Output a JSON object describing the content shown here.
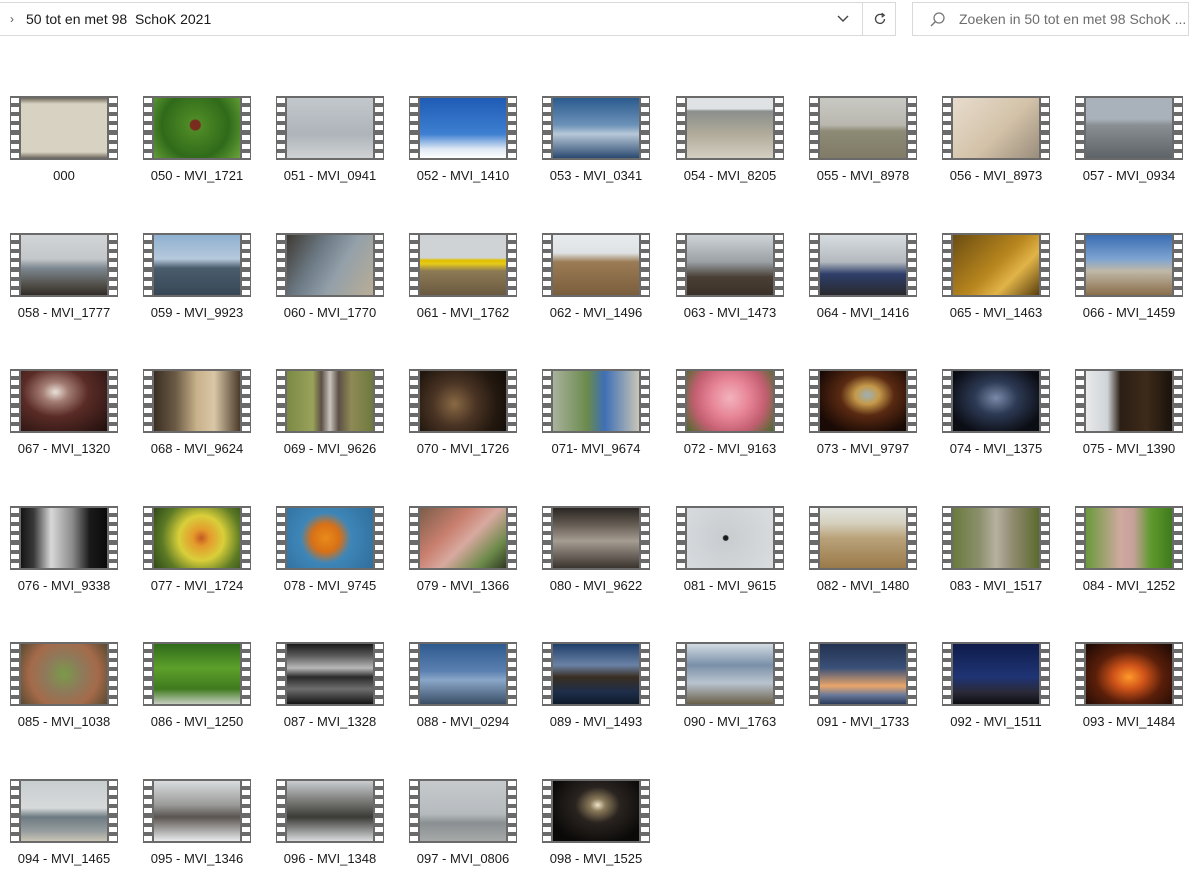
{
  "address_bar": {
    "path": "50 tot en met 98  SchoK 2021",
    "icons": {
      "expand": "chevron-right-icon",
      "dropdown": "chevron-down-icon",
      "refresh": "refresh-icon"
    }
  },
  "search": {
    "placeholder": "Zoeken in 50 tot en met 98  SchoK ...",
    "icon": "search-icon"
  },
  "files": [
    {
      "name": "000",
      "thumb": "linear-gradient(#6f6a5e 0%,#d8d2c2 10%,#d8d2c2 90%,#6f6a5e 100%)"
    },
    {
      "name": "050 - MVI_1721",
      "thumb": "radial-gradient(circle at 48% 45%,#7a2d1f 0,#7a2d1f 9%,#4e8a25 11%,#2f6a1a 60%,#6aa33a 100%)"
    },
    {
      "name": "051 - MVI_0941",
      "thumb": "linear-gradient(#c3c8cc,#aeb4ba 60%,#cfd2d4)"
    },
    {
      "name": "052 - MVI_1410",
      "thumb": "linear-gradient(#1f5bb5 0%,#3e7fd1 60%,#dfe9f5 85%,#ffffff 100%)"
    },
    {
      "name": "053 - MVI_0341",
      "thumb": "linear-gradient(#2a5a8e 0%,#6c92b8 45%,#b7c8d8 60%,#2b4a70 100%)"
    },
    {
      "name": "054 - MVI_8205",
      "thumb": "linear-gradient(#dfe3e6 0%,#dfe3e6 18%,#8a8f8c 22%,#b1ab9a 60%,#d3cfc2 100%)"
    },
    {
      "name": "055 - MVI_8978",
      "thumb": "linear-gradient(#c9c9c4 0%,#b9b7ae 45%,#8d8a76 55%,#7f7b66 100%)"
    },
    {
      "name": "056 - MVI_8973",
      "thumb": "linear-gradient(135deg,#e7dccd,#d3c2a8 55%,#9a8d7c)"
    },
    {
      "name": "057 - MVI_0934",
      "thumb": "linear-gradient(#a9b2ba 0%,#a9b2ba 35%,#8a8f94 45%,#5e6368 100%)"
    },
    {
      "name": "058 - MVI_1777",
      "thumb": "linear-gradient(#d2d5d7 0%,#c4c7c9 40%,#7d8892 55%,#4f4b45 85%,#302b26 100%)"
    },
    {
      "name": "059 - MVI_9923",
      "thumb": "linear-gradient(#8fb0d0 0%,#b6c9dc 40%,#4a5d6d 55%,#374756 100%)"
    },
    {
      "name": "060 - MVI_1770",
      "thumb": "linear-gradient(120deg,#3f3a33 0%,#6d7b86 35%,#93a0aa 60%,#b9ad95 100%)"
    },
    {
      "name": "061 - MVI_1762",
      "thumb": "linear-gradient(#cfd3d6 0%,#cfd3d6 38%,#e0c000 42%,#e7c91a 48%,#8d7a55 60%,#6a5a40 100%)"
    },
    {
      "name": "062 - MVI_1496",
      "thumb": "linear-gradient(#e9ecee 0%,#dfe2e4 30%,#9a7b55 45%,#7b5e3d 100%)"
    },
    {
      "name": "063 - MVI_1473",
      "thumb": "linear-gradient(#cfd4d8 0%,#9aa0a4 45%,#4a3f35 70%,#3a3128 100%)"
    },
    {
      "name": "064 - MVI_1416",
      "thumb": "linear-gradient(#d8dde1 0%,#b3b9be 45%,#2e3f6a 65%,#2a2a2e 100%)"
    },
    {
      "name": "065 - MVI_1463",
      "thumb": "linear-gradient(135deg,#6b4d12,#b8861e 50%,#e1b448 70%,#5a3f0e)"
    },
    {
      "name": "066 - MVI_1459",
      "thumb": "linear-gradient(#3a6db2 0%,#7ea4d1 40%,#c0b8a8 60%,#8a6e4a 100%)"
    },
    {
      "name": "067 - MVI_1320",
      "thumb": "radial-gradient(ellipse at 40% 35%,#e9e2d8 0,#a37c73 18%,#5a2b26 45%,#1f0f0d 100%)"
    },
    {
      "name": "068 - MVI_9624",
      "thumb": "linear-gradient(90deg,#3a2f24 0%,#6b5a45 25%,#c9b28c 50%,#d9c7a6 70%,#4a3b2b 100%)"
    },
    {
      "name": "069 - MVI_9626",
      "thumb": "linear-gradient(90deg,#7a8a45 0%,#9aa25a 30%,#5c5046 40%,#c9c4bd 50%,#5c5046 60%,#8f8a55 75%,#6d7a3c 100%)"
    },
    {
      "name": "070 - MVI_1726",
      "thumb": "radial-gradient(circle at 40% 55%,#8a6a45 0,#4a3424 35%,#23180f 70%,#120c08 100%)"
    },
    {
      "name": "071- MVI_9674",
      "thumb": "linear-gradient(90deg,#a9b29c 0%,#6a8a4c 40%,#3e6fb5 60%,#c8c6b7 100%)"
    },
    {
      "name": "072 - MVI_9163",
      "thumb": "radial-gradient(circle at 50% 45%,#f2b3bd 0,#e78596 35%,#c45f72 65%,#4b6a2c 100%)"
    },
    {
      "name": "073 - MVI_9797",
      "thumb": "radial-gradient(ellipse at 55% 40%,#9fb0b8 0,#c59a4a 18%,#5a2a12 40%,#1a0a05 80%)"
    },
    {
      "name": "074 - MVI_1375",
      "thumb": "radial-gradient(ellipse at 50% 45%,#7a8aa8 0,#2d3a55 35%,#0b0d14 80%)"
    },
    {
      "name": "075 - MVI_1390",
      "thumb": "linear-gradient(90deg,#e8e9ea 0%,#cfd4d8 25%,#2b1e14 40%,#3d2a1a 70%,#1a120c 100%)"
    },
    {
      "name": "076 - MVI_9338",
      "thumb": "linear-gradient(90deg,#151515 0%,#3a3a3a 15%,#d8d8d8 35%,#8a8a8a 60%,#1a1a1a 80%,#0a0a0a 100%)"
    },
    {
      "name": "077 - MVI_1724",
      "thumb": "radial-gradient(circle at 55% 50%,#c35a22 0,#e49a2c 15%,#d9cf3a 40%,#5c7a25 70%,#2f4a18 100%)"
    },
    {
      "name": "078 - MVI_9745",
      "thumb": "radial-gradient(circle at 45% 50%,#e98b1a 0,#d87016 25%,#3e86b8 45%,#2f6e9c 100%)"
    },
    {
      "name": "079 - MVI_1366",
      "thumb": "linear-gradient(135deg,#7c5d4a,#c97f6e 35%,#d8a9a0 55%,#6d8a4a 80%,#2f3a22)"
    },
    {
      "name": "080 - MVI_9622",
      "thumb": "linear-gradient(#2a2622 0%,#6a6158 30%,#a59c92 55%,#3a342e 100%)"
    },
    {
      "name": "081 - MVI_9615",
      "thumb": "radial-gradient(circle at 45% 50%,#1a1a1a 0,#1a1a1a 4%,#c9cdd0 6%,#dadde0 100%)"
    },
    {
      "name": "082 - MVI_1480",
      "thumb": "linear-gradient(#e3e4df 0%,#d6d1bf 25%,#b9a27a 50%,#9a7a4a 100%)"
    },
    {
      "name": "083 - MVI_1517",
      "thumb": "linear-gradient(90deg,#6a7a3c 0%,#8a8f6a 30%,#b6b0a0 50%,#8f8a6e 70%,#5c6a2e 100%)"
    },
    {
      "name": "084 - MVI_1252",
      "thumb": "linear-gradient(90deg,#6a9a3a 0%,#cfa9a0 40%,#c7a09a 55%,#5f9a2e 75%,#3f7a1e 100%)"
    },
    {
      "name": "085 - MVI_1038",
      "thumb": "radial-gradient(circle at 50% 50%,#7a9a4a 0,#8e7a5a 35%,#a46a4a 65%,#5a4a30 100%)"
    },
    {
      "name": "086 - MVI_1250",
      "thumb": "linear-gradient(#2f6a1a 0%,#5da02a 40%,#3f7a1e 75%,#c7cfc0 100%)"
    },
    {
      "name": "087 - MVI_1328",
      "thumb": "linear-gradient(#1a1a1a 0%,#5c5c5c 20%,#b9b9b9 40%,#2a2a2a 55%,#6e6e6e 75%,#151515 100%)"
    },
    {
      "name": "088 - MVI_0294",
      "thumb": "linear-gradient(#2f5a8e 0%,#5a80b0 45%,#8aa7c9 60%,#3a4e66 100%)"
    },
    {
      "name": "089 - MVI_1493",
      "thumb": "linear-gradient(#1f3f6a 0%,#6a82a6 35%,#3a2e22 55%,#1e2e4a 80%,#0f1a2a 100%)"
    },
    {
      "name": "090 - MVI_1763",
      "thumb": "linear-gradient(#d2dbe3 0%,#7a90a8 35%,#b9c4cf 65%,#6a6048 100%)"
    },
    {
      "name": "091 - MVI_1733",
      "thumb": "linear-gradient(#223250 0%,#3a5078 40%,#e9a66a 70%,#6a7a9a 85%,#2a3a5a 100%)"
    },
    {
      "name": "092 - MVI_1511",
      "thumb": "linear-gradient(#0f1c4a 0%,#1f3475 55%,#2a2a38 80%,#0d0d12 100%)"
    },
    {
      "name": "093 - MVI_1484",
      "thumb": "radial-gradient(ellipse at 50% 55%,#ff9a2a 0,#d2551a 25%,#5a1f0a 55%,#1a0804 100%)"
    },
    {
      "name": "094 - MVI_1465",
      "thumb": "linear-gradient(#c8cdd0 0%,#d7dadb 45%,#6d7a82 60%,#9aa0a0 85%,#c9c4b5 100%)"
    },
    {
      "name": "095 - MVI_1346",
      "thumb": "linear-gradient(#d8dcdf 0%,#9a9a98 40%,#5a5450 60%,#e9ebec 100%)"
    },
    {
      "name": "096 - MVI_1348",
      "thumb": "linear-gradient(#c9cdd0 0%,#6a6a66 40%,#3a3a36 60%,#d9dcdd 100%)"
    },
    {
      "name": "097 - MVI_0806",
      "thumb": "linear-gradient(#c6cacd 0%,#b5babd 55%,#8a8f92 70%,#a6a9a8 100%)"
    },
    {
      "name": "098 - MVI_1525",
      "thumb": "radial-gradient(ellipse at 52% 40%,#f0e6c8 0,#8a7a5a 12%,#2a2420 35%,#0a0908 80%)"
    }
  ]
}
